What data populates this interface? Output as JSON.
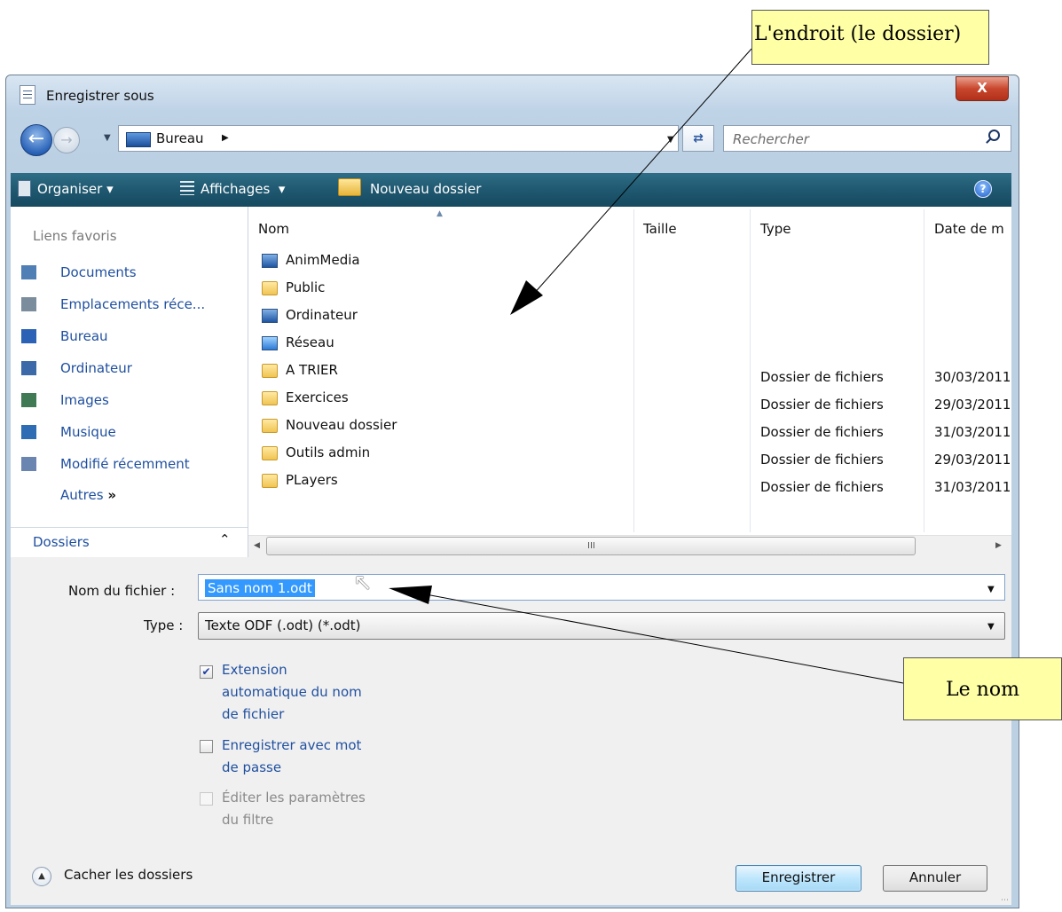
{
  "window": {
    "title": "Enregistrer sous",
    "close_label": "X"
  },
  "address": {
    "path": "Bureau",
    "search_placeholder": "Rechercher"
  },
  "toolbar": {
    "organize": "Organiser",
    "views": "Affichages",
    "new_folder": "Nouveau dossier",
    "help": "?"
  },
  "favorites": {
    "heading": "Liens favoris",
    "items": [
      {
        "label": "Documents",
        "icon": "documents-icon"
      },
      {
        "label": "Emplacements réce...",
        "icon": "recent-places-icon"
      },
      {
        "label": "Bureau",
        "icon": "desktop-icon"
      },
      {
        "label": "Ordinateur",
        "icon": "computer-icon"
      },
      {
        "label": "Images",
        "icon": "pictures-icon"
      },
      {
        "label": "Musique",
        "icon": "music-icon"
      },
      {
        "label": "Modifié récemment",
        "icon": "recently-changed-icon"
      }
    ],
    "more": "Autres",
    "more_glyph": "»"
  },
  "folders_toggle": "Dossiers",
  "columns": [
    "Nom",
    "Taille",
    "Type",
    "Date de m"
  ],
  "files": [
    {
      "name": "AnimMedia",
      "icon": "user-folder-icon",
      "type": "",
      "date": ""
    },
    {
      "name": "Public",
      "icon": "folder-icon",
      "type": "",
      "date": ""
    },
    {
      "name": "Ordinateur",
      "icon": "computer-icon",
      "type": "",
      "date": ""
    },
    {
      "name": "Réseau",
      "icon": "network-icon",
      "type": "",
      "date": ""
    },
    {
      "name": "A TRIER",
      "icon": "folder-icon",
      "type": "Dossier de fichiers",
      "date": "30/03/2011"
    },
    {
      "name": "Exercices",
      "icon": "folder-icon",
      "type": "Dossier de fichiers",
      "date": "29/03/2011"
    },
    {
      "name": "Nouveau dossier",
      "icon": "folder-icon",
      "type": "Dossier de fichiers",
      "date": "31/03/2011"
    },
    {
      "name": "Outils admin",
      "icon": "folder-icon",
      "type": "Dossier de fichiers",
      "date": "29/03/2011"
    },
    {
      "name": "PLayers",
      "icon": "folder-icon",
      "type": "Dossier de fichiers",
      "date": "31/03/2011"
    }
  ],
  "scroll_grip": "III",
  "form": {
    "filename_label": "Nom du fichier :",
    "filename_value": "Sans nom 1.odt",
    "type_label": "Type :",
    "type_value": "Texte ODF (.odt) (*.odt)"
  },
  "options": [
    {
      "label": "Extension\nautomatique du nom\nde fichier",
      "checked": true,
      "enabled": true
    },
    {
      "label": "Enregistrer avec mot\nde passe",
      "checked": false,
      "enabled": true
    },
    {
      "label": "Éditer les paramètres\ndu filtre",
      "checked": false,
      "enabled": false
    }
  ],
  "hide_folders": "Cacher les dossiers",
  "buttons": {
    "save": "Enregistrer",
    "cancel": "Annuler"
  },
  "annotations": {
    "location": "L'endroit (le dossier)",
    "name": "Le nom"
  }
}
